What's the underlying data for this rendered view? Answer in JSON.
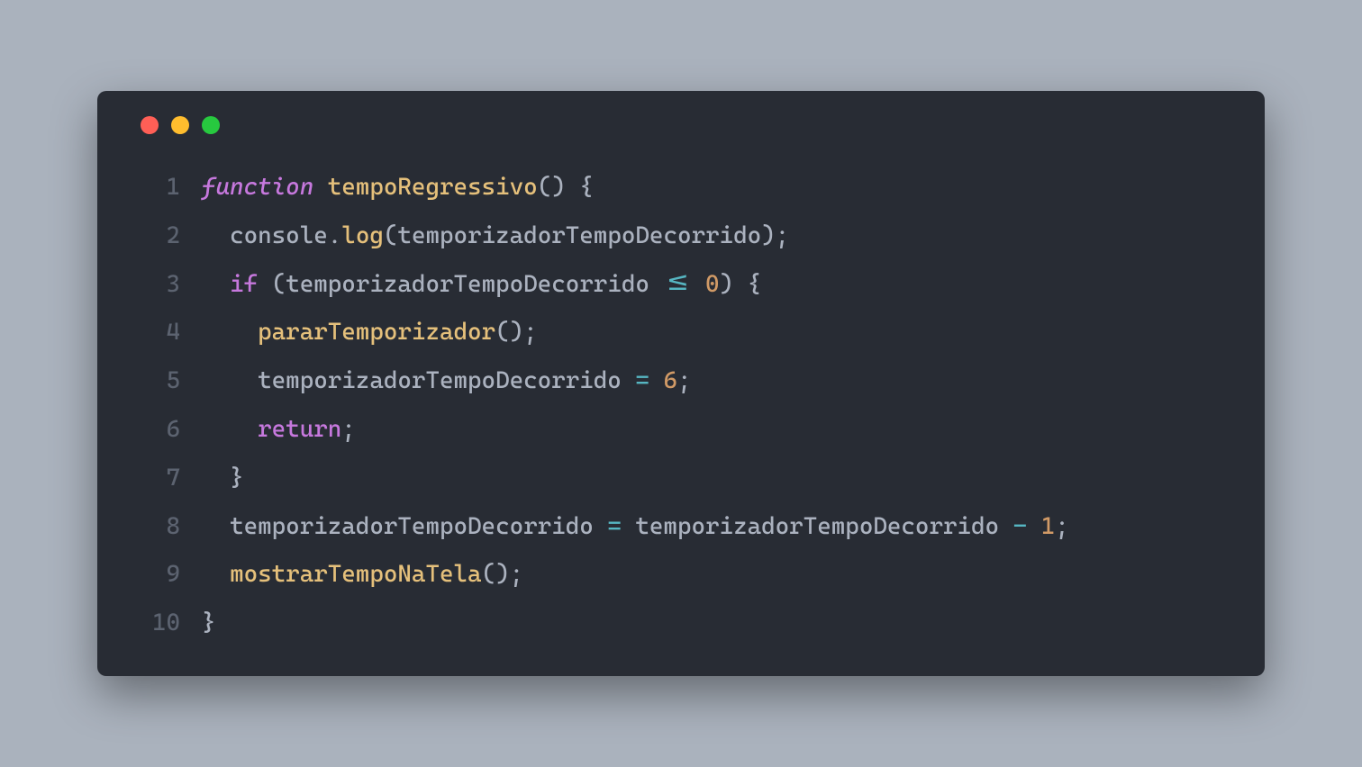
{
  "window": {
    "traffic_lights": [
      "red",
      "yellow",
      "green"
    ]
  },
  "code": {
    "language": "javascript",
    "lines": [
      {
        "num": "1",
        "tokens": [
          {
            "text": "function",
            "cls": "token-keyword"
          },
          {
            "text": " ",
            "cls": ""
          },
          {
            "text": "tempoRegressivo",
            "cls": "token-function"
          },
          {
            "text": "()",
            "cls": "token-paren"
          },
          {
            "text": " ",
            "cls": ""
          },
          {
            "text": "{",
            "cls": "token-brace"
          }
        ]
      },
      {
        "num": "2",
        "tokens": [
          {
            "text": "  ",
            "cls": ""
          },
          {
            "text": "console",
            "cls": "token-object"
          },
          {
            "text": ".",
            "cls": "token-dot"
          },
          {
            "text": "log",
            "cls": "token-method"
          },
          {
            "text": "(",
            "cls": "token-paren"
          },
          {
            "text": "temporizadorTempoDecorrido",
            "cls": "token-identifier"
          },
          {
            "text": ")",
            "cls": "token-paren"
          },
          {
            "text": ";",
            "cls": "token-punctuation"
          }
        ]
      },
      {
        "num": "3",
        "tokens": [
          {
            "text": "  ",
            "cls": ""
          },
          {
            "text": "if",
            "cls": "token-keyword-plain"
          },
          {
            "text": " ",
            "cls": ""
          },
          {
            "text": "(",
            "cls": "token-paren"
          },
          {
            "text": "temporizadorTempoDecorrido",
            "cls": "token-identifier"
          },
          {
            "text": " ",
            "cls": ""
          },
          {
            "text": "<=",
            "cls": "token-operator"
          },
          {
            "text": " ",
            "cls": ""
          },
          {
            "text": "0",
            "cls": "token-number"
          },
          {
            "text": ")",
            "cls": "token-paren"
          },
          {
            "text": " ",
            "cls": ""
          },
          {
            "text": "{",
            "cls": "token-brace"
          }
        ]
      },
      {
        "num": "4",
        "tokens": [
          {
            "text": "    ",
            "cls": ""
          },
          {
            "text": "pararTemporizador",
            "cls": "token-function-call"
          },
          {
            "text": "()",
            "cls": "token-paren"
          },
          {
            "text": ";",
            "cls": "token-punctuation"
          }
        ]
      },
      {
        "num": "5",
        "tokens": [
          {
            "text": "    ",
            "cls": ""
          },
          {
            "text": "temporizadorTempoDecorrido",
            "cls": "token-identifier"
          },
          {
            "text": " ",
            "cls": ""
          },
          {
            "text": "=",
            "cls": "token-operator"
          },
          {
            "text": " ",
            "cls": ""
          },
          {
            "text": "6",
            "cls": "token-number"
          },
          {
            "text": ";",
            "cls": "token-punctuation"
          }
        ]
      },
      {
        "num": "6",
        "tokens": [
          {
            "text": "    ",
            "cls": ""
          },
          {
            "text": "return",
            "cls": "token-keyword-plain"
          },
          {
            "text": ";",
            "cls": "token-punctuation"
          }
        ]
      },
      {
        "num": "7",
        "tokens": [
          {
            "text": "  ",
            "cls": ""
          },
          {
            "text": "}",
            "cls": "token-brace"
          }
        ]
      },
      {
        "num": "8",
        "tokens": [
          {
            "text": "  ",
            "cls": ""
          },
          {
            "text": "temporizadorTempoDecorrido",
            "cls": "token-identifier"
          },
          {
            "text": " ",
            "cls": ""
          },
          {
            "text": "=",
            "cls": "token-operator"
          },
          {
            "text": " ",
            "cls": ""
          },
          {
            "text": "temporizadorTempoDecorrido",
            "cls": "token-identifier"
          },
          {
            "text": " ",
            "cls": ""
          },
          {
            "text": "-",
            "cls": "token-operator"
          },
          {
            "text": " ",
            "cls": ""
          },
          {
            "text": "1",
            "cls": "token-number"
          },
          {
            "text": ";",
            "cls": "token-punctuation"
          }
        ]
      },
      {
        "num": "9",
        "tokens": [
          {
            "text": "  ",
            "cls": ""
          },
          {
            "text": "mostrarTempoNaTela",
            "cls": "token-function-call"
          },
          {
            "text": "()",
            "cls": "token-paren"
          },
          {
            "text": ";",
            "cls": "token-punctuation"
          }
        ]
      },
      {
        "num": "10",
        "tokens": [
          {
            "text": "}",
            "cls": "token-brace"
          }
        ]
      }
    ]
  }
}
